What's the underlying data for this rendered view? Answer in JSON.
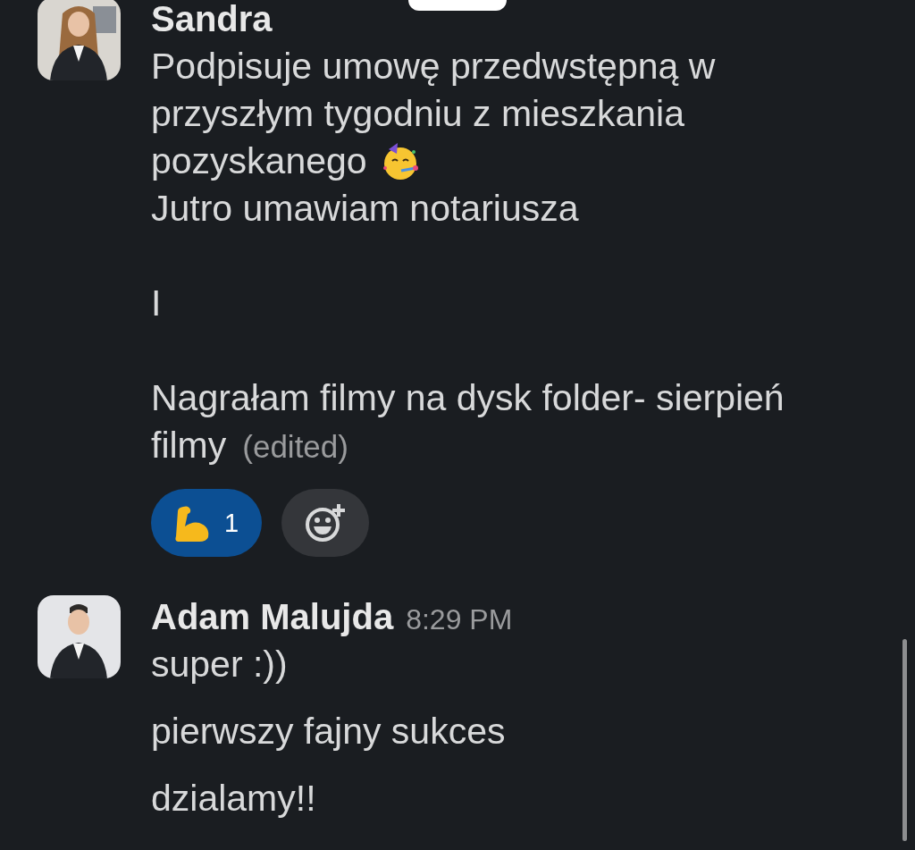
{
  "messages": [
    {
      "author": "Sandra",
      "avatar": {
        "kind": "picture"
      },
      "blocks": [
        {
          "lines": [
            {
              "text": "Podpisuje umowę przedwstępną w"
            },
            {
              "text": "przyszłym tygodniu z mieszkania"
            },
            {
              "text": "pozyskanego",
              "emoji": true
            },
            {
              "text": "Jutro umawiam notariusza"
            }
          ]
        },
        {
          "lines": [
            {
              "text": "I"
            }
          ]
        },
        {
          "lines": [
            {
              "text": "Nagrałam filmy na dysk folder- sierpień"
            },
            {
              "text": "filmy",
              "edited": "(edited)"
            }
          ]
        }
      ],
      "reactions": [
        {
          "kind": "emoji",
          "count": "1",
          "selected": true
        },
        {
          "kind": "add"
        }
      ]
    },
    {
      "author": "Adam Malujda",
      "time": "8:29 PM",
      "avatar": {
        "kind": "picture"
      },
      "blocks": [
        {
          "lines": [
            {
              "text": "super :))"
            }
          ]
        },
        {
          "lines": [
            {
              "text": "pierwszy fajny sukces"
            }
          ]
        },
        {
          "lines": [
            {
              "text": "dzialamy!!"
            }
          ]
        }
      ]
    }
  ]
}
